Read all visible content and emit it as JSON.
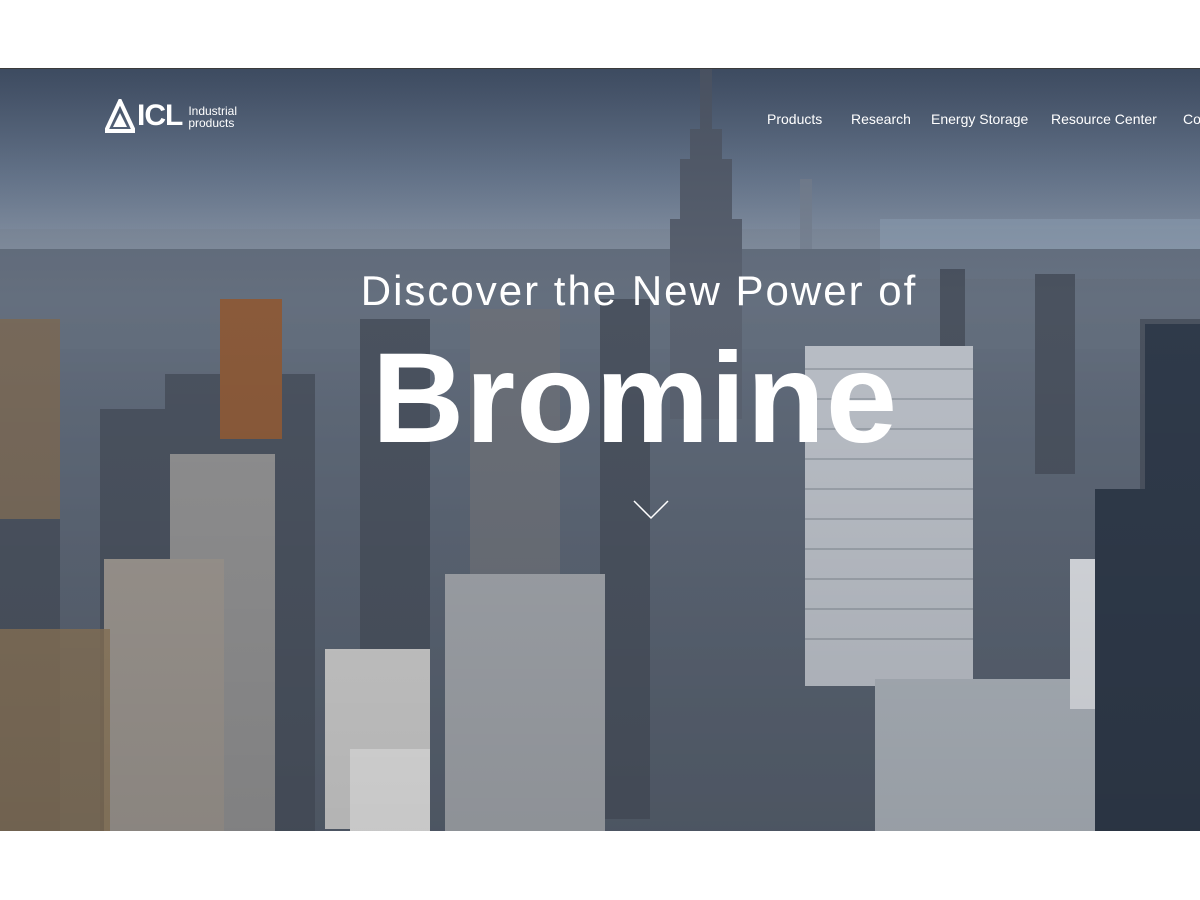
{
  "logo": {
    "brand": "ICL",
    "sub_line1": "Industrial",
    "sub_line2": "products"
  },
  "nav": {
    "items": [
      "Products",
      "Research",
      "Energy Storage",
      "Resource Center",
      "Co"
    ]
  },
  "hero": {
    "headline_small": "Discover the New Power of",
    "headline_big": "Bromine",
    "background": "aerial-city-skyline-image",
    "scroll_icon": "chevron-down-icon"
  },
  "colors": {
    "text": "#ffffff",
    "page_background": "#ffffff",
    "sky": "#6f7f95"
  }
}
